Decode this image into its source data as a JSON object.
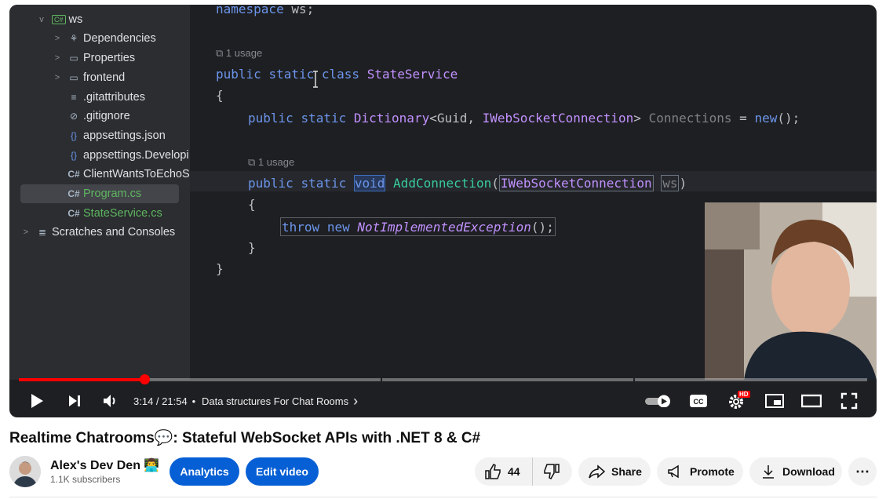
{
  "ide": {
    "tree": [
      {
        "label": "ws",
        "badge": "C#",
        "chevron": "v",
        "icon": "csharp-project-icon"
      },
      {
        "label": "Dependencies",
        "chevron": ">",
        "icon": "dependencies-icon"
      },
      {
        "label": "Properties",
        "chevron": ">",
        "icon": "folder-icon"
      },
      {
        "label": "frontend",
        "chevron": ">",
        "icon": "folder-icon"
      },
      {
        "label": ".gitattributes",
        "icon": "lines-icon"
      },
      {
        "label": ".gitignore",
        "icon": "ignore-icon"
      },
      {
        "label": "appsettings.json",
        "icon": "braces-icon"
      },
      {
        "label": "appsettings.Developi",
        "icon": "braces-icon"
      },
      {
        "label": "ClientWantsToEchoS",
        "icon": "csharp-file-icon"
      },
      {
        "label": "Program.cs",
        "icon": "csharp-file-icon"
      },
      {
        "label": "StateService.cs",
        "icon": "csharp-file-icon"
      },
      {
        "label": "Scratches and Consoles",
        "chevron": ">",
        "icon": "scratches-icon"
      }
    ],
    "file_icon_text": "C#",
    "code": {
      "l0": [
        "namespace",
        " ws;"
      ],
      "usage1": "1 usage",
      "l1": [
        "public",
        " ",
        "static",
        " ",
        "class",
        " ",
        "StateService"
      ],
      "brace_open": "{",
      "l2": [
        "public",
        " ",
        "static",
        " ",
        "Dictionary",
        "<Guid, ",
        "IWebSocketConnection",
        "> ",
        "Connections",
        " = ",
        "new",
        "();"
      ],
      "usage2": "1 usage",
      "l3": [
        "public",
        " ",
        "static",
        " ",
        "void",
        " ",
        "AddConnection",
        "(",
        "IWebSocketConnection",
        " ",
        "ws",
        ")"
      ],
      "brace_open2": "{",
      "l4": [
        "throw",
        " ",
        "new",
        " ",
        "NotImplementedException",
        "();"
      ],
      "brace_close2": "}",
      "brace_close": "}"
    }
  },
  "player": {
    "time": "3:14 / 21:54",
    "separator": "•",
    "chapter": "Data structures For Chat Rooms",
    "chapter_chevron": "›",
    "progress_fraction": 0.148,
    "hd_badge": "HD"
  },
  "video": {
    "title": "Realtime Chatrooms💬: Stateful WebSocket APIs with .NET 8 & C#",
    "channel": "Alex's Dev Den 👨‍💻",
    "subscribers": "1.1K subscribers"
  },
  "actions": {
    "analytics": "Analytics",
    "edit_video": "Edit video",
    "likes": "44",
    "share": "Share",
    "promote": "Promote",
    "download": "Download",
    "more": "⋯"
  },
  "colors": {
    "brand_red": "#ff0000",
    "youtube_blue": "#065fd4",
    "ide_bg": "#1e1f22"
  }
}
